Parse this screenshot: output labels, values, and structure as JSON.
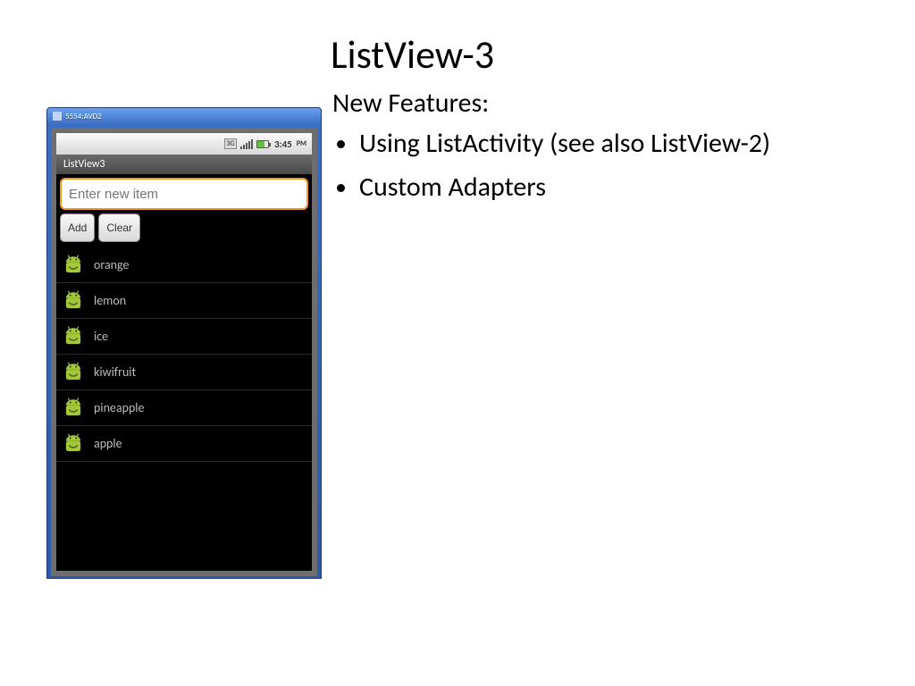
{
  "slide": {
    "title": "ListView-3",
    "subtitle": "New Features:",
    "bullets": [
      "Using ListActivity (see also ListView-2)",
      "Custom Adapters"
    ]
  },
  "emulator": {
    "window_title": "5554:AVD2",
    "status": {
      "network_label": "3G",
      "time": "3:45",
      "ampm": "PM"
    },
    "app_title": "ListView3",
    "input_placeholder": "Enter new item",
    "buttons": {
      "add": "Add",
      "clear": "Clear"
    },
    "list_items": [
      "orange",
      "lemon",
      "ice",
      "kiwifruit",
      "pineapple",
      "apple"
    ]
  }
}
